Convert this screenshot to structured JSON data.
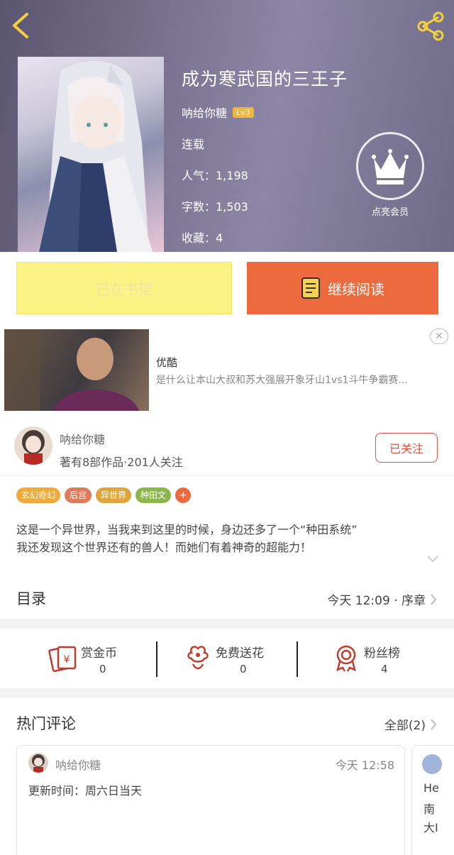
{
  "header": {
    "back_icon": "chevron-left-icon",
    "share_icon": "share-icon"
  },
  "book": {
    "title": "成为寒武国的三王子",
    "author": "呐给你糖",
    "level": "Lv3",
    "status": "连载",
    "popularity": "人气：1,198",
    "word_count": "字数：1,503",
    "collections": "收藏：4",
    "vip_label": "点亮会员"
  },
  "actions": {
    "shelf_label": "已在书架",
    "read_label": "继续阅读"
  },
  "ad": {
    "title": "优酷",
    "description": "是什么让本山大叔和苏大强展开象牙山1vs1斗牛争霸赛...",
    "close": "✕"
  },
  "author_card": {
    "name": "呐给你糖",
    "stats": "著有8部作品·201人关注",
    "follow_label": "已关注"
  },
  "tags": [
    {
      "label": "玄幻奇幻",
      "color": "#f0a93a"
    },
    {
      "label": "后宫",
      "color": "#e07a5a"
    },
    {
      "label": "异世界",
      "color": "#e0a53a"
    },
    {
      "label": "种田文",
      "color": "#8bb74a"
    }
  ],
  "tag_more": "+",
  "synopsis": [
    "这是一个异世界，当我来到这里的时候，身边还多了一个“种田系统”",
    "我还发现这个世界还有的兽人！而她们有着神奇的超能力！"
  ],
  "toc": {
    "title": "目录",
    "latest": "今天 12:09 · 序章"
  },
  "support": {
    "reward": {
      "label": "赏金币",
      "value": "0"
    },
    "flower": {
      "label": "免费送花",
      "value": "0"
    },
    "fans": {
      "label": "粉丝榜",
      "value": "4"
    }
  },
  "comments": {
    "title": "热门评论",
    "all_label": "全部(2)",
    "first": {
      "user": "呐给你糖",
      "time": "今天 12:58",
      "text": "更新时间：周六日当天"
    },
    "second_lines": [
      "He",
      "南",
      "大I"
    ]
  },
  "colors": {
    "accent": "#ec6a3d",
    "follow": "#e0523c",
    "shelf_bg": "#fdf284"
  }
}
